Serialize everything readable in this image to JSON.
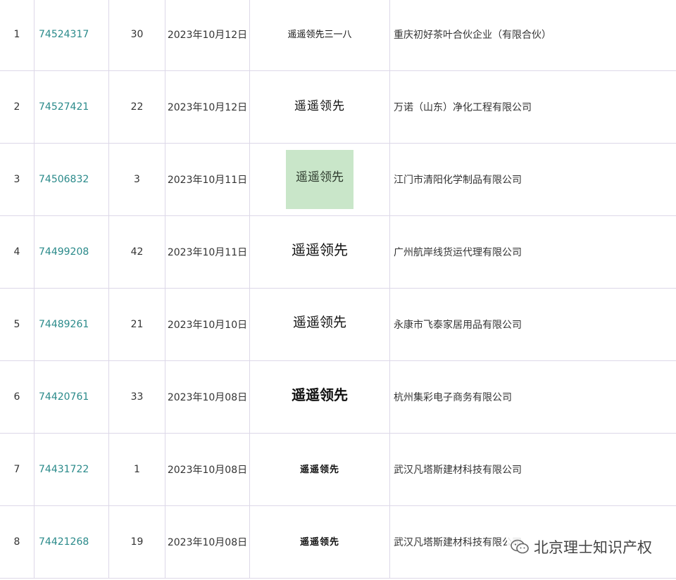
{
  "rows": [
    {
      "no": "1",
      "reg_no": "74524317",
      "class": "30",
      "date": "2023年10月12日",
      "mark": "遥遥领先三一八",
      "applicant": "重庆初好茶叶合伙企业（有限合伙）"
    },
    {
      "no": "2",
      "reg_no": "74527421",
      "class": "22",
      "date": "2023年10月12日",
      "mark": "遥遥领先",
      "applicant": "万诺（山东）净化工程有限公司"
    },
    {
      "no": "3",
      "reg_no": "74506832",
      "class": "3",
      "date": "2023年10月11日",
      "mark": "遥遥领先",
      "applicant": "江门市清阳化学制品有限公司"
    },
    {
      "no": "4",
      "reg_no": "74499208",
      "class": "42",
      "date": "2023年10月11日",
      "mark": "遥遥领先",
      "applicant": "广州航岸线货运代理有限公司"
    },
    {
      "no": "5",
      "reg_no": "74489261",
      "class": "21",
      "date": "2023年10月10日",
      "mark": "遥遥领先",
      "applicant": "永康市飞泰家居用品有限公司"
    },
    {
      "no": "6",
      "reg_no": "74420761",
      "class": "33",
      "date": "2023年10月08日",
      "mark": "遥遥领先",
      "applicant": "杭州集彩电子商务有限公司"
    },
    {
      "no": "7",
      "reg_no": "74431722",
      "class": "1",
      "date": "2023年10月08日",
      "mark": "遥遥领先",
      "applicant": "武汉凡塔斯建材科技有限公司"
    },
    {
      "no": "8",
      "reg_no": "74421268",
      "class": "19",
      "date": "2023年10月08日",
      "mark": "遥遥领先",
      "applicant": "武汉凡塔斯建材科技有限公司"
    }
  ],
  "watermark": {
    "text": "北京理士知识产权",
    "icon": "wechat-icon"
  },
  "colors": {
    "link": "#2a8a8a",
    "grid": "#ddd8e8",
    "mark3_bg": "#c9e6c9"
  }
}
